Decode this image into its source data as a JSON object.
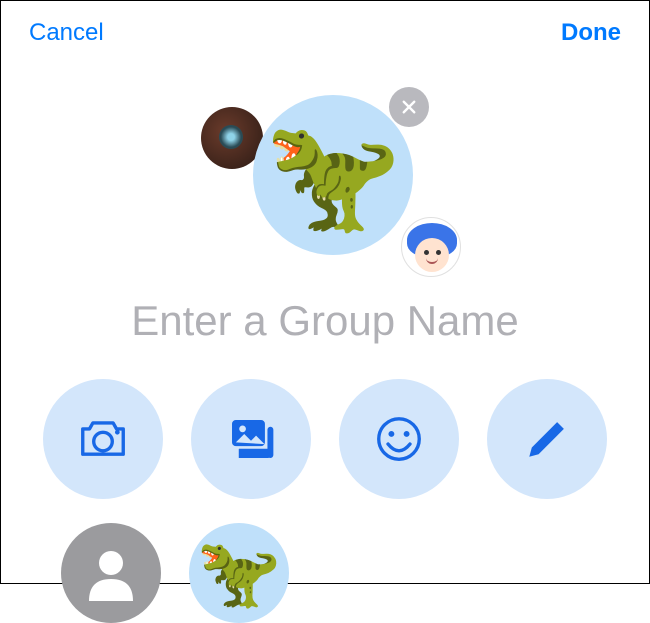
{
  "header": {
    "cancel_label": "Cancel",
    "done_label": "Done"
  },
  "group_avatar": {
    "main_icon": "dinosaur-emoji",
    "main_emoji": "🦖",
    "left_icon": "camera-lens-photo",
    "right_icon": "memoji-blue-hair",
    "close_icon": "close-x"
  },
  "name_field": {
    "value": "",
    "placeholder": "Enter a Group Name"
  },
  "actions": [
    {
      "id": "camera",
      "icon": "camera-icon"
    },
    {
      "id": "gallery",
      "icon": "photo-gallery-icon"
    },
    {
      "id": "emoji",
      "icon": "smiley-icon"
    },
    {
      "id": "edit",
      "icon": "pencil-icon"
    }
  ],
  "secondary_row": {
    "gray_icon": "person-silhouette",
    "blue_icon": "dinosaur-emoji",
    "blue_emoji": "🦖"
  },
  "colors": {
    "ios_blue": "#007aff",
    "icon_blue": "#1868e6",
    "action_bg": "#d3e6fb",
    "avatar_bg": "#bfe0fa"
  }
}
